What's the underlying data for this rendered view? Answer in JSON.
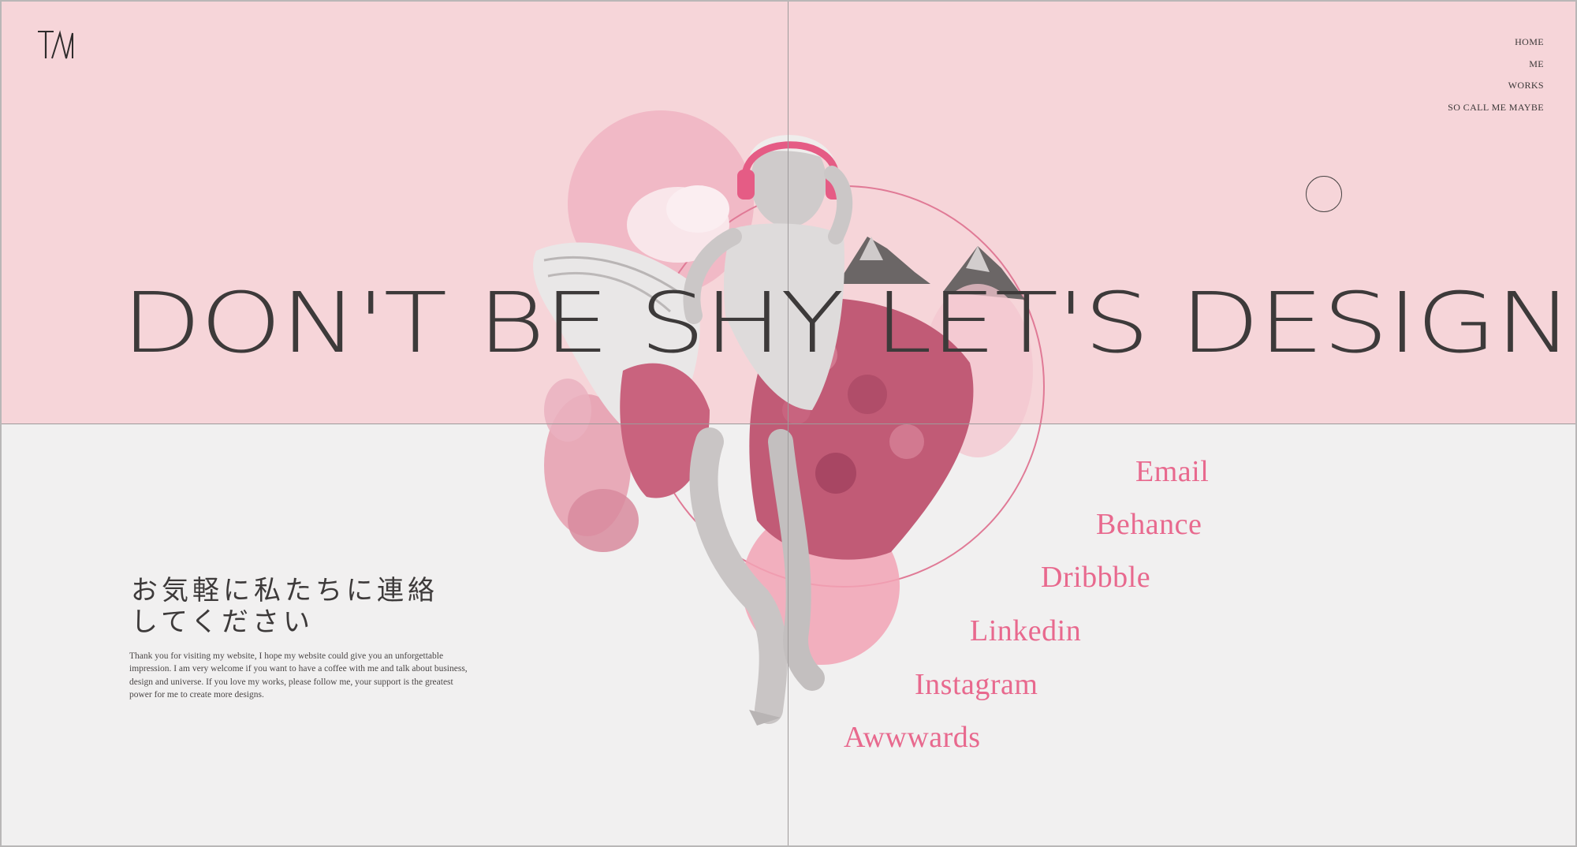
{
  "brand": {
    "logo_text": "TM"
  },
  "nav": {
    "items": [
      "HOME",
      "ME",
      "WORKS",
      "SO CALL ME MAYBE"
    ]
  },
  "hero": {
    "headline": "DON'T BE SHY LET'S DESIGN"
  },
  "contact": {
    "jp_line1": "お気軽に私たちに連絡",
    "jp_line2": "してください",
    "description": "Thank you for visiting my website, I hope my website could give you an unforgettable impression. I am very welcome if you want to have a coffee with me and talk about business, design and universe. If you love my works, please follow me, your support is the greatest power for me to create more designs."
  },
  "links": [
    "Email",
    "Behance",
    "Dribbble",
    "Linkedin",
    "Instagram",
    "Awwwards"
  ],
  "colors": {
    "top_background": "#f6d5d9",
    "bottom_background": "#f1f0f0",
    "accent_pink": "#e8698e",
    "text_dark": "#3d3a3a"
  }
}
